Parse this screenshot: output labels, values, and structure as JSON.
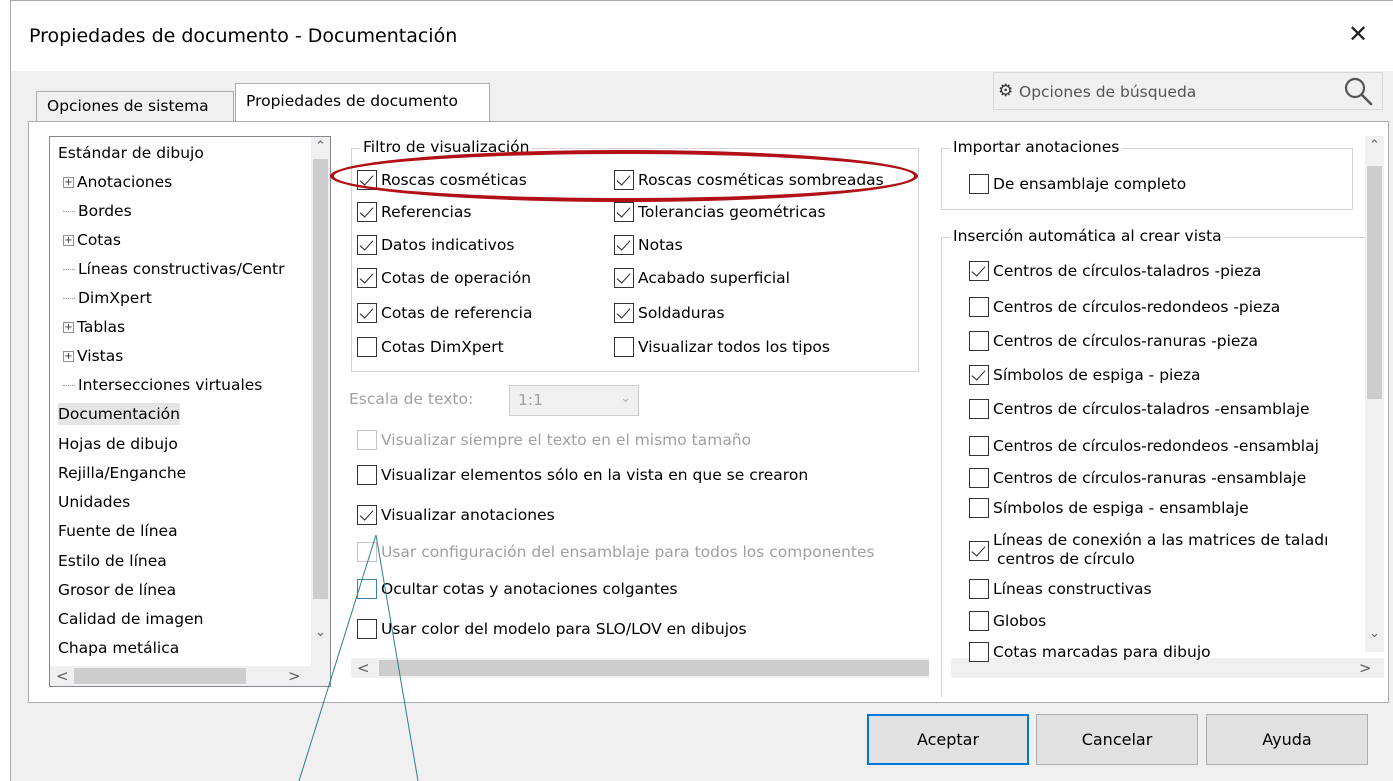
{
  "window": {
    "title": "Propiedades de documento - Documentación",
    "close_glyph": "✕"
  },
  "tabs": [
    {
      "label": "Opciones de sistema",
      "active": false
    },
    {
      "label": "Propiedades de documento",
      "active": true
    }
  ],
  "search": {
    "placeholder": "Opciones de búsqueda",
    "icon_left": "gear-icon",
    "icon_right": "magnifier-icon"
  },
  "tree": {
    "items": [
      {
        "label": "Estándar de dibujo",
        "level": 0,
        "expander": false,
        "selected": false
      },
      {
        "label": "Anotaciones",
        "level": 1,
        "expander": true,
        "selected": false
      },
      {
        "label": "Bordes",
        "level": 1,
        "expander": false,
        "selected": false
      },
      {
        "label": "Cotas",
        "level": 1,
        "expander": true,
        "selected": false
      },
      {
        "label": "Líneas constructivas/Centr",
        "level": 1,
        "expander": false,
        "selected": false
      },
      {
        "label": "DimXpert",
        "level": 1,
        "expander": false,
        "selected": false
      },
      {
        "label": "Tablas",
        "level": 1,
        "expander": true,
        "selected": false
      },
      {
        "label": "Vistas",
        "level": 1,
        "expander": true,
        "selected": false
      },
      {
        "label": "Intersecciones virtuales",
        "level": 1,
        "expander": false,
        "selected": false
      },
      {
        "label": "Documentación",
        "level": 0,
        "expander": false,
        "selected": true
      },
      {
        "label": "Hojas de dibujo",
        "level": 0,
        "expander": false,
        "selected": false
      },
      {
        "label": "Rejilla/Enganche",
        "level": 0,
        "expander": false,
        "selected": false
      },
      {
        "label": "Unidades",
        "level": 0,
        "expander": false,
        "selected": false
      },
      {
        "label": "Fuente de línea",
        "level": 0,
        "expander": false,
        "selected": false
      },
      {
        "label": "Estilo de línea",
        "level": 0,
        "expander": false,
        "selected": false
      },
      {
        "label": "Grosor de línea",
        "level": 0,
        "expander": false,
        "selected": false
      },
      {
        "label": "Calidad de imagen",
        "level": 0,
        "expander": false,
        "selected": false
      },
      {
        "label": "Chapa metálica",
        "level": 0,
        "expander": false,
        "selected": false
      }
    ]
  },
  "filter": {
    "title": "Filtro de visualización",
    "left": [
      {
        "label": "Roscas cosméticas",
        "checked": true
      },
      {
        "label": "Referencias",
        "checked": true
      },
      {
        "label": "Datos indicativos",
        "checked": true
      },
      {
        "label": "Cotas de operación",
        "checked": true
      },
      {
        "label": "Cotas de referencia",
        "checked": true
      },
      {
        "label": "Cotas DimXpert",
        "checked": false
      }
    ],
    "right": [
      {
        "label": "Roscas cosméticas sombreadas",
        "checked": true
      },
      {
        "label": "Tolerancias geométricas",
        "checked": true
      },
      {
        "label": "Notas",
        "checked": true
      },
      {
        "label": "Acabado superficial",
        "checked": true
      },
      {
        "label": "Soldaduras",
        "checked": true
      },
      {
        "label": "Visualizar todos los tipos",
        "checked": false
      }
    ]
  },
  "text_scale": {
    "label": "Escala de texto:",
    "value": "1:1"
  },
  "options": [
    {
      "label": "Visualizar siempre el texto en el mismo tamaño",
      "checked": false,
      "disabled": true
    },
    {
      "label": "Visualizar elementos sólo en la vista en que se crearon",
      "checked": false,
      "disabled": false
    },
    {
      "label": "Visualizar anotaciones",
      "checked": true,
      "disabled": false
    },
    {
      "label": "Usar configuración del ensamblaje para todos los componentes",
      "checked": false,
      "disabled": true
    },
    {
      "label": "Ocultar cotas y anotaciones colgantes",
      "checked": false,
      "disabled": false
    },
    {
      "label": "Usar color del modelo para SLO/LOV en dibujos",
      "checked": false,
      "disabled": false
    }
  ],
  "import": {
    "title": "Importar anotaciones",
    "items": [
      {
        "label": "De ensamblaje completo",
        "checked": false
      }
    ]
  },
  "auto_insert": {
    "title": "Inserción automática al crear vista",
    "items": [
      {
        "label": "Centros de círculos-taladros -pieza",
        "checked": true
      },
      {
        "label": "Centros de círculos-redondeos -pieza",
        "checked": false
      },
      {
        "label": "Centros de círculos-ranuras  -pieza",
        "checked": false
      },
      {
        "label": "Símbolos de espiga - pieza",
        "checked": true
      },
      {
        "label": "Centros de círculos-taladros -ensamblaje",
        "checked": false
      },
      {
        "label": "Centros de círculos-redondeos -ensamblaj",
        "checked": false
      },
      {
        "label": "Centros de círculos-ranuras  -ensamblaje",
        "checked": false
      },
      {
        "label": "Símbolos de espiga - ensamblaje",
        "checked": false
      },
      {
        "label": "Líneas de conexión a las matrices de taladı",
        "label2": "centros de círculo",
        "checked": true
      },
      {
        "label": "Líneas constructivas",
        "checked": false
      },
      {
        "label": "Globos",
        "checked": false
      },
      {
        "label": "Cotas marcadas para dibujo",
        "checked": false
      }
    ]
  },
  "buttons": {
    "ok": "Aceptar",
    "cancel": "Cancelar",
    "help": "Ayuda"
  },
  "scroll_glyphs": {
    "up": "⌃",
    "down": "⌄",
    "left": "<",
    "right": ">"
  },
  "colors": {
    "annotation_red": "#b01016",
    "focus_blue": "#0078d7"
  }
}
